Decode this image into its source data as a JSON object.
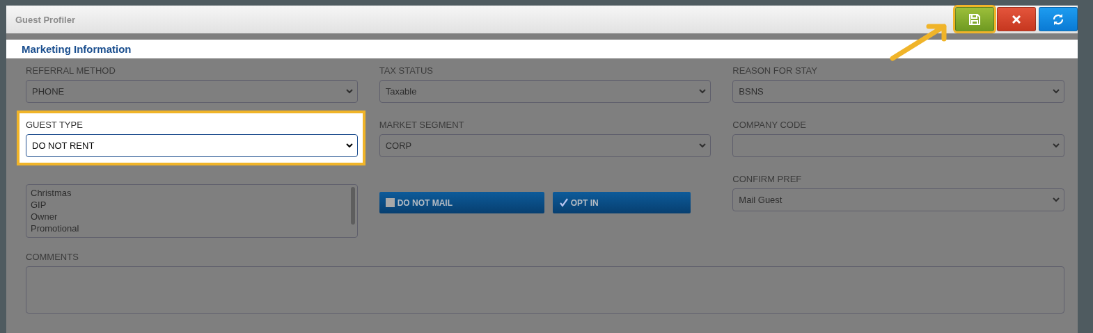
{
  "window": {
    "title": "Guest Profiler"
  },
  "toolbar": [
    {
      "kind": "save",
      "highlighted": true
    },
    {
      "kind": "cancel",
      "highlighted": false
    },
    {
      "kind": "refresh",
      "highlighted": false
    }
  ],
  "section": {
    "title": "Marketing Information"
  },
  "rows": [
    [
      {
        "kind": "select",
        "label": "REFERRAL METHOD",
        "value": "PHONE",
        "highlighted": false
      },
      {
        "kind": "select",
        "label": "TAX STATUS",
        "value": "Taxable",
        "highlighted": false
      },
      {
        "kind": "select",
        "label": "REASON FOR STAY",
        "value": "BSNS",
        "highlighted": false
      }
    ],
    [
      {
        "kind": "select",
        "label": "GUEST TYPE",
        "value": "DO NOT RENT",
        "highlighted": true
      },
      {
        "kind": "select",
        "label": "MARKET SEGMENT",
        "value": "CORP",
        "highlighted": false
      },
      {
        "kind": "select",
        "label": "COMPANY CODE",
        "highlighted": false
      }
    ],
    [
      {
        "kind": "listbox",
        "items": [
          "Christmas",
          "GIP",
          "Owner",
          "Promotional"
        ]
      },
      {
        "kind": "toggles",
        "items": [
          {
            "label": "DO NOT MAIL",
            "checked": false
          },
          {
            "label": "OPT IN",
            "checked": true
          }
        ]
      },
      {
        "kind": "select",
        "label": "CONFIRM PREF",
        "value": "Mail Guest",
        "highlighted": false
      }
    ]
  ],
  "comments": {
    "label": "COMMENTS"
  }
}
